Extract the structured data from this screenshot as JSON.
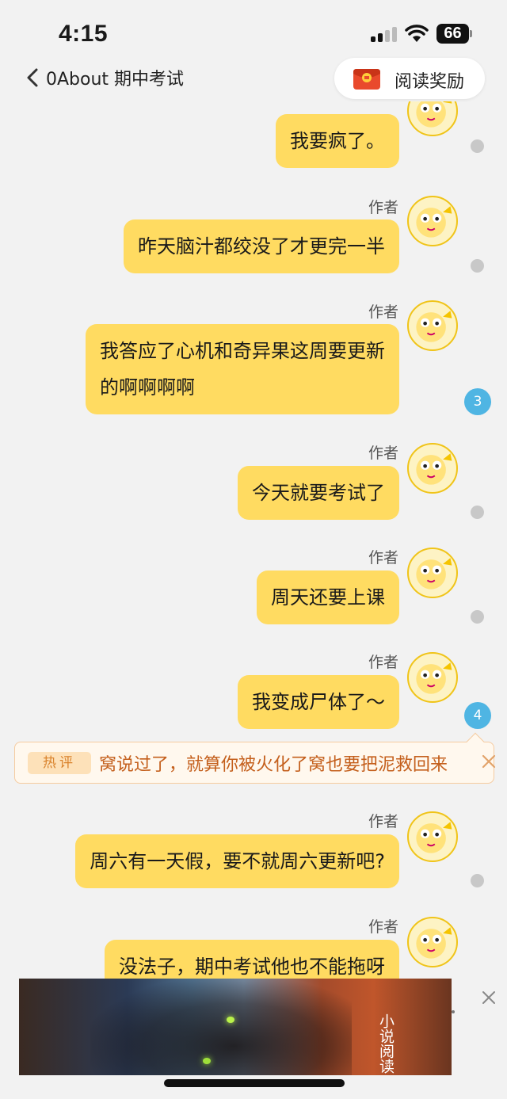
{
  "status_bar": {
    "time": "4:15",
    "battery": "66"
  },
  "nav": {
    "back_title": "0About 期中考试",
    "reward_label": "阅读奖励"
  },
  "messages": [
    {
      "author": "",
      "text_lines": [
        "我要疯了。"
      ]
    },
    {
      "author": "作者",
      "text_lines": [
        "昨天脑汁都绞没了才更完一半"
      ]
    },
    {
      "author": "作者",
      "text_lines": [
        "我答应了心机和奇异果这周要更新",
        "的啊啊啊啊"
      ],
      "comment_count": "3"
    },
    {
      "author": "作者",
      "text_lines": [
        "今天就要考试了"
      ]
    },
    {
      "author": "作者",
      "text_lines": [
        "周天还要上课"
      ]
    },
    {
      "author": "作者",
      "text_lines": [
        "我变成尸体了～"
      ],
      "comment_count": "4"
    },
    {
      "author": "作者",
      "text_lines": [
        "周六有一天假，要不就周六更新吧?"
      ]
    },
    {
      "author": "作者",
      "text_lines": [
        "没法子，期中考试他也不能拖呀"
      ]
    }
  ],
  "hot_comment": {
    "tag": "热评",
    "text": "窝说过了，就算你被火化了窝也要把泥救回来"
  },
  "ad": {
    "title": "小说阅读"
  },
  "colors": {
    "bubble": "#ffdb61",
    "badge": "#4fb5e3",
    "hot_text": "#c45f1c"
  }
}
